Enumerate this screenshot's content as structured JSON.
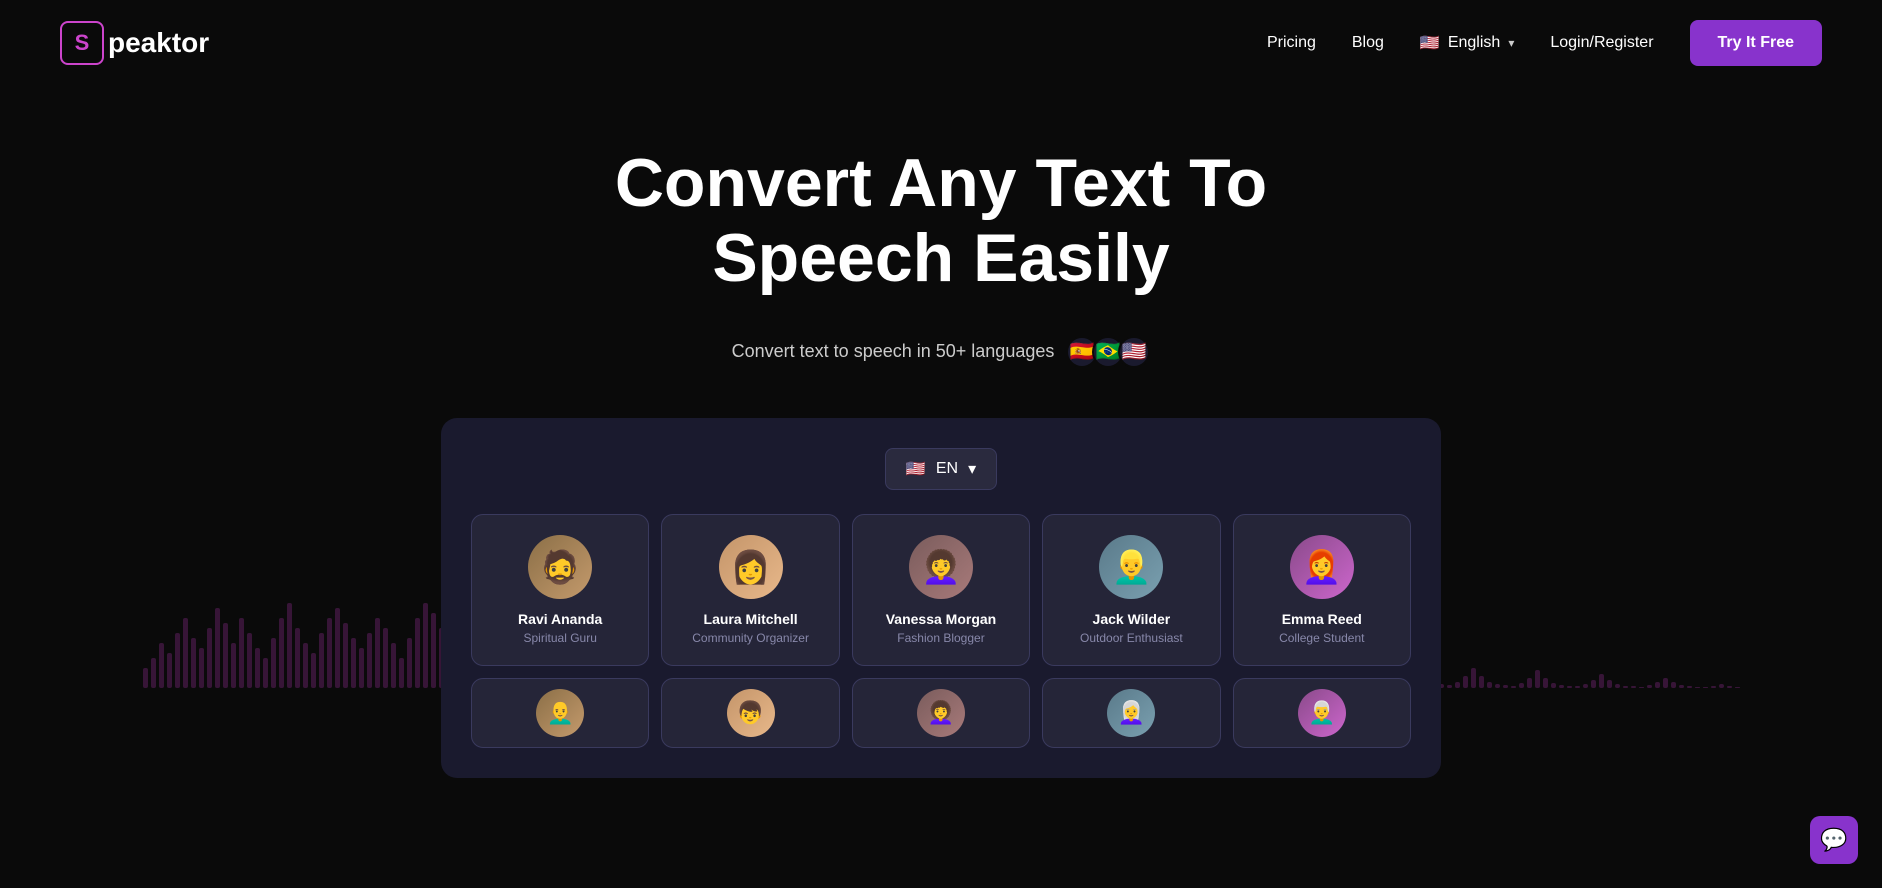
{
  "brand": {
    "logo_letter": "S",
    "logo_name": "peaktor"
  },
  "navbar": {
    "pricing_label": "Pricing",
    "blog_label": "Blog",
    "language_label": "English",
    "login_label": "Login/Register",
    "try_free_label": "Try It Free"
  },
  "hero": {
    "title": "Convert Any Text To Speech Easily",
    "subtitle": "Convert text to speech in 50+ languages",
    "flags": [
      "🇪🇸",
      "🇧🇷",
      "🇺🇸"
    ]
  },
  "demo": {
    "lang_selector": {
      "flag": "🇺🇸",
      "code": "EN",
      "chevron": "▾"
    },
    "voices_row1": [
      {
        "name": "Ravi Ananda",
        "role": "Spiritual Guru",
        "avatar_class": "avatar-ravi",
        "emoji": "🧔"
      },
      {
        "name": "Laura Mitchell",
        "role": "Community Organizer",
        "avatar_class": "avatar-laura",
        "emoji": "👩"
      },
      {
        "name": "Vanessa Morgan",
        "role": "Fashion Blogger",
        "avatar_class": "avatar-vanessa",
        "emoji": "👩‍🦱"
      },
      {
        "name": "Jack Wilder",
        "role": "Outdoor Enthusiast",
        "avatar_class": "avatar-jack",
        "emoji": "👱‍♂️"
      },
      {
        "name": "Emma Reed",
        "role": "College Student",
        "avatar_class": "avatar-emma",
        "emoji": "👩‍🦰"
      }
    ],
    "voices_row2": [
      {
        "emoji": "👨‍🦲",
        "avatar_class": "avatar-ravi"
      },
      {
        "emoji": "👦",
        "avatar_class": "avatar-laura"
      },
      {
        "emoji": "👩‍🦱",
        "avatar_class": "avatar-vanessa"
      },
      {
        "emoji": "👩‍🦳",
        "avatar_class": "avatar-jack"
      },
      {
        "emoji": "👨‍🦳",
        "avatar_class": "avatar-emma"
      }
    ]
  },
  "chat_button": {
    "icon": "💬"
  }
}
